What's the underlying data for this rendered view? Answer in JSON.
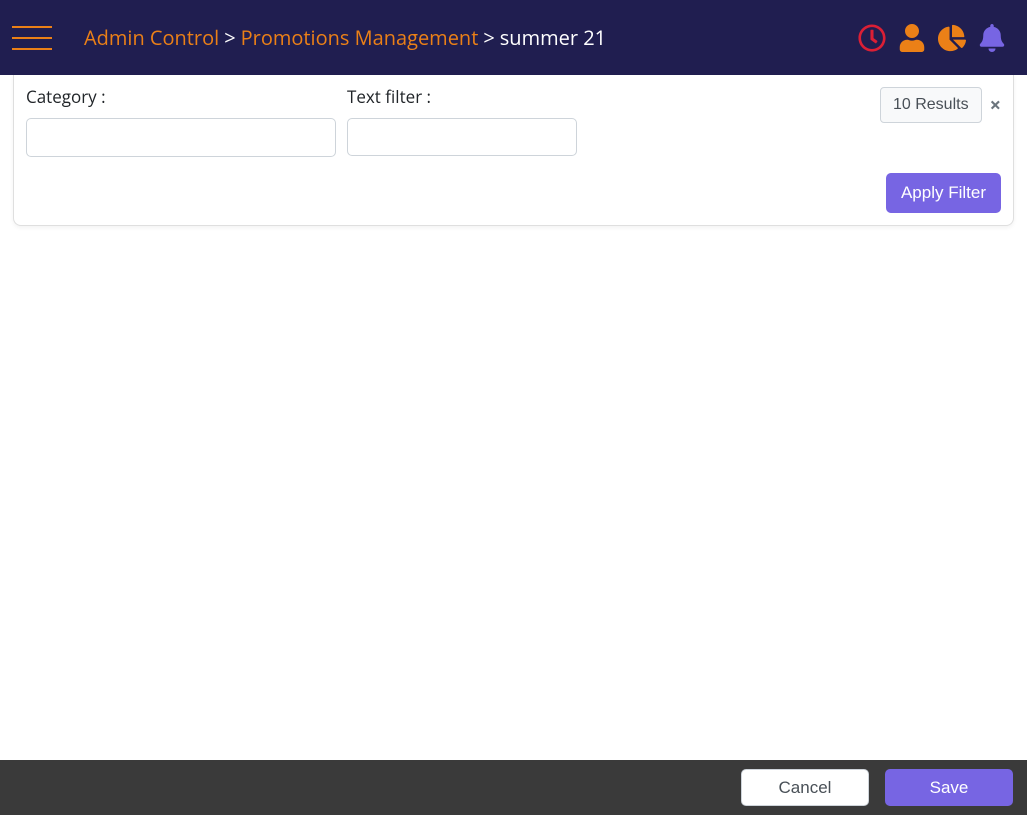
{
  "breadcrumb": {
    "level1": "Admin Control",
    "level2": "Promotions Management",
    "current": "summer 21",
    "separator": ">"
  },
  "colors": {
    "accent_orange": "#eb8017",
    "accent_red": "#db1f35",
    "accent_purple": "#7765e3",
    "navbar_bg": "#201e50"
  },
  "nav_icons": {
    "clock": "clock-icon",
    "user": "user-icon",
    "chart": "chart-pie-icon",
    "bell": "bell-icon"
  },
  "filter": {
    "category_label": "Category :",
    "category_value": "",
    "text_filter_label": "Text filter :",
    "text_filter_value": "",
    "results_label": "10 Results",
    "apply_label": "Apply Filter"
  },
  "footer": {
    "cancel_label": "Cancel",
    "save_label": "Save"
  }
}
